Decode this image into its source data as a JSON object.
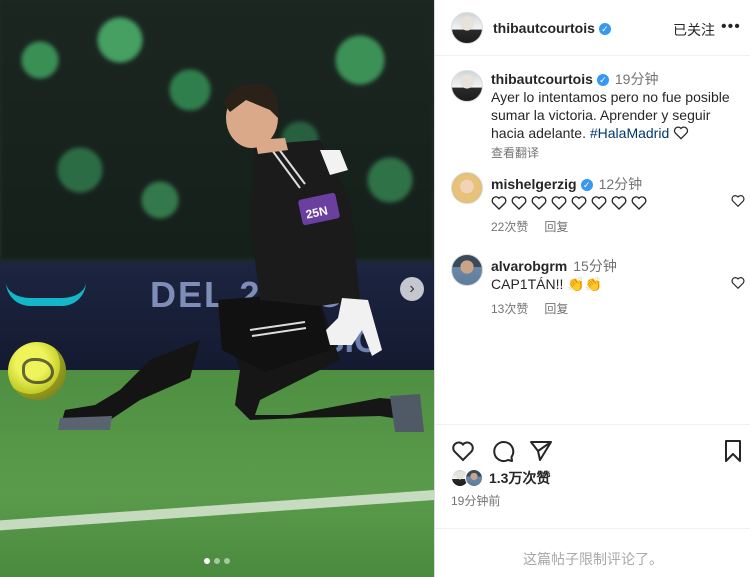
{
  "photo": {
    "board_text_1": "DEL 2",
    "board_text_2": "NO",
    "board_text_3": "BIC",
    "armband_text": "25N",
    "slide_dots": 3,
    "active_dot": 0
  },
  "header": {
    "username": "thibautcourtois",
    "follow_label": "已关注",
    "more_label": "•••"
  },
  "caption": {
    "username": "thibautcourtois",
    "time": "19分钟",
    "text": "Ayer lo intentamos pero no fue posible sumar la victoria. Aprender y seguir hacia adelante. ",
    "hashtag": "#HalaMadrid",
    "translate_label": "查看翻译"
  },
  "comments": [
    {
      "username": "mishelgerzig",
      "verified": true,
      "time": "12分钟",
      "text": "",
      "heart_emoji_count": 8,
      "likes": "22次赞",
      "reply": "回复"
    },
    {
      "username": "alvarobgrm",
      "verified": false,
      "time": "15分钟",
      "text": "CAP1TÁN!! 👏👏",
      "likes": "13次赞",
      "reply": "回复"
    }
  ],
  "footer": {
    "likes_count": "1.3万次赞",
    "posted_ago": "19分钟前",
    "comments_restricted": "这篇帖子限制评论了。"
  },
  "colors": {
    "verified_blue": "#3897f0",
    "hashtag": "#00376b",
    "muted_text": "#737373"
  }
}
